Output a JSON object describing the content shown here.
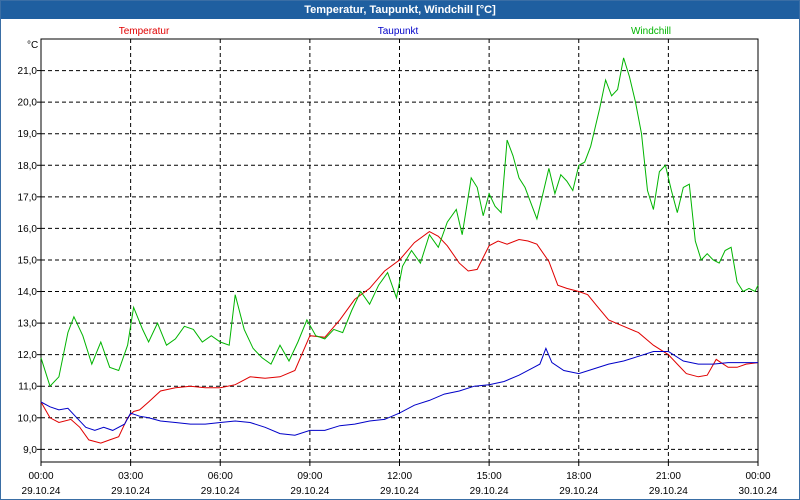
{
  "window": {
    "title": "Temperatur, Taupunkt, Windchill [°C]"
  },
  "chart_data": {
    "type": "line",
    "title": "Temperatur, Taupunkt, Windchill [°C]",
    "ylabel": "°C",
    "ylim": [
      8.6,
      22.0
    ],
    "yticks": [
      "9,0",
      "10,0",
      "11,0",
      "12,0",
      "13,0",
      "14,0",
      "15,0",
      "16,0",
      "17,0",
      "18,0",
      "19,0",
      "20,0",
      "21,0"
    ],
    "xlim": [
      0,
      24
    ],
    "xticks": [
      {
        "time": "00:00",
        "date": "29.10.24"
      },
      {
        "time": "03:00",
        "date": "29.10.24"
      },
      {
        "time": "06:00",
        "date": "29.10.24"
      },
      {
        "time": "09:00",
        "date": "29.10.24"
      },
      {
        "time": "12:00",
        "date": "29.10.24"
      },
      {
        "time": "15:00",
        "date": "29.10.24"
      },
      {
        "time": "18:00",
        "date": "29.10.24"
      },
      {
        "time": "21:00",
        "date": "29.10.24"
      },
      {
        "time": "00:00",
        "date": "30.10.24"
      }
    ],
    "grid": true,
    "legend_position": "top",
    "series": [
      {
        "name": "Temperatur",
        "color": "#e00000",
        "points": [
          [
            0,
            10.5
          ],
          [
            0.3,
            10.0
          ],
          [
            0.6,
            9.85
          ],
          [
            1.0,
            9.95
          ],
          [
            1.3,
            9.7
          ],
          [
            1.6,
            9.3
          ],
          [
            2.0,
            9.2
          ],
          [
            2.3,
            9.3
          ],
          [
            2.6,
            9.4
          ],
          [
            2.9,
            10.0
          ],
          [
            3.1,
            10.2
          ],
          [
            3.3,
            10.25
          ],
          [
            3.6,
            10.5
          ],
          [
            4.0,
            10.85
          ],
          [
            4.5,
            10.95
          ],
          [
            5.0,
            11.0
          ],
          [
            5.5,
            10.95
          ],
          [
            6.0,
            10.95
          ],
          [
            6.5,
            11.05
          ],
          [
            7.0,
            11.3
          ],
          [
            7.5,
            11.25
          ],
          [
            8.0,
            11.3
          ],
          [
            8.5,
            11.5
          ],
          [
            9.0,
            12.6
          ],
          [
            9.5,
            12.55
          ],
          [
            10.0,
            13.1
          ],
          [
            10.5,
            13.75
          ],
          [
            11.0,
            14.1
          ],
          [
            11.5,
            14.65
          ],
          [
            12.0,
            15.0
          ],
          [
            12.5,
            15.55
          ],
          [
            13.0,
            15.9
          ],
          [
            13.3,
            15.75
          ],
          [
            13.6,
            15.45
          ],
          [
            14.0,
            14.9
          ],
          [
            14.3,
            14.65
          ],
          [
            14.6,
            14.7
          ],
          [
            15.0,
            15.45
          ],
          [
            15.3,
            15.6
          ],
          [
            15.6,
            15.5
          ],
          [
            16.0,
            15.65
          ],
          [
            16.3,
            15.6
          ],
          [
            16.6,
            15.5
          ],
          [
            17.0,
            14.95
          ],
          [
            17.3,
            14.2
          ],
          [
            17.6,
            14.1
          ],
          [
            18.0,
            14.0
          ],
          [
            18.3,
            13.9
          ],
          [
            18.6,
            13.55
          ],
          [
            19.0,
            13.1
          ],
          [
            19.5,
            12.9
          ],
          [
            20.0,
            12.7
          ],
          [
            20.5,
            12.3
          ],
          [
            21.0,
            12.0
          ],
          [
            21.3,
            11.7
          ],
          [
            21.6,
            11.4
          ],
          [
            22.0,
            11.3
          ],
          [
            22.3,
            11.35
          ],
          [
            22.6,
            11.85
          ],
          [
            23.0,
            11.6
          ],
          [
            23.3,
            11.6
          ],
          [
            23.6,
            11.7
          ],
          [
            24.0,
            11.75
          ]
        ]
      },
      {
        "name": "Taupunkt",
        "color": "#0000c8",
        "points": [
          [
            0,
            10.5
          ],
          [
            0.3,
            10.35
          ],
          [
            0.6,
            10.25
          ],
          [
            0.9,
            10.3
          ],
          [
            1.2,
            10.0
          ],
          [
            1.5,
            9.7
          ],
          [
            1.8,
            9.6
          ],
          [
            2.1,
            9.7
          ],
          [
            2.4,
            9.6
          ],
          [
            2.8,
            9.8
          ],
          [
            3.0,
            10.15
          ],
          [
            3.3,
            10.05
          ],
          [
            3.6,
            10.0
          ],
          [
            4.0,
            9.9
          ],
          [
            4.5,
            9.85
          ],
          [
            5.0,
            9.8
          ],
          [
            5.5,
            9.8
          ],
          [
            6.0,
            9.85
          ],
          [
            6.5,
            9.9
          ],
          [
            7.0,
            9.85
          ],
          [
            7.5,
            9.7
          ],
          [
            8.0,
            9.5
          ],
          [
            8.5,
            9.45
          ],
          [
            9.0,
            9.6
          ],
          [
            9.5,
            9.6
          ],
          [
            10.0,
            9.75
          ],
          [
            10.5,
            9.8
          ],
          [
            11.0,
            9.9
          ],
          [
            11.5,
            9.95
          ],
          [
            12.0,
            10.15
          ],
          [
            12.5,
            10.4
          ],
          [
            13.0,
            10.55
          ],
          [
            13.5,
            10.75
          ],
          [
            14.0,
            10.85
          ],
          [
            14.5,
            11.0
          ],
          [
            15.0,
            11.05
          ],
          [
            15.5,
            11.15
          ],
          [
            16.0,
            11.35
          ],
          [
            16.5,
            11.6
          ],
          [
            16.7,
            11.7
          ],
          [
            16.9,
            12.2
          ],
          [
            17.1,
            11.75
          ],
          [
            17.5,
            11.5
          ],
          [
            18.0,
            11.4
          ],
          [
            18.5,
            11.55
          ],
          [
            19.0,
            11.7
          ],
          [
            19.5,
            11.8
          ],
          [
            20.0,
            11.95
          ],
          [
            20.5,
            12.1
          ],
          [
            21.0,
            12.1
          ],
          [
            21.5,
            11.8
          ],
          [
            22.0,
            11.7
          ],
          [
            22.5,
            11.7
          ],
          [
            23.0,
            11.75
          ],
          [
            23.5,
            11.75
          ],
          [
            24.0,
            11.75
          ]
        ]
      },
      {
        "name": "Windchill",
        "color": "#00b400",
        "points": [
          [
            0,
            11.9
          ],
          [
            0.3,
            11.0
          ],
          [
            0.6,
            11.3
          ],
          [
            0.9,
            12.7
          ],
          [
            1.1,
            13.2
          ],
          [
            1.4,
            12.6
          ],
          [
            1.7,
            11.7
          ],
          [
            2.0,
            12.4
          ],
          [
            2.3,
            11.6
          ],
          [
            2.6,
            11.5
          ],
          [
            2.9,
            12.3
          ],
          [
            3.1,
            13.5
          ],
          [
            3.4,
            12.8
          ],
          [
            3.6,
            12.4
          ],
          [
            3.9,
            13.0
          ],
          [
            4.2,
            12.3
          ],
          [
            4.5,
            12.5
          ],
          [
            4.8,
            12.9
          ],
          [
            5.1,
            12.8
          ],
          [
            5.4,
            12.4
          ],
          [
            5.7,
            12.6
          ],
          [
            6.0,
            12.4
          ],
          [
            6.3,
            12.3
          ],
          [
            6.5,
            13.9
          ],
          [
            6.8,
            12.8
          ],
          [
            7.1,
            12.2
          ],
          [
            7.4,
            11.9
          ],
          [
            7.7,
            11.7
          ],
          [
            8.0,
            12.3
          ],
          [
            8.3,
            11.8
          ],
          [
            8.6,
            12.4
          ],
          [
            8.9,
            13.1
          ],
          [
            9.2,
            12.6
          ],
          [
            9.5,
            12.5
          ],
          [
            9.8,
            12.8
          ],
          [
            10.1,
            12.7
          ],
          [
            10.4,
            13.4
          ],
          [
            10.7,
            14.0
          ],
          [
            11.0,
            13.6
          ],
          [
            11.3,
            14.2
          ],
          [
            11.6,
            14.6
          ],
          [
            11.9,
            13.8
          ],
          [
            12.1,
            14.8
          ],
          [
            12.4,
            15.3
          ],
          [
            12.7,
            14.9
          ],
          [
            13.0,
            15.8
          ],
          [
            13.3,
            15.4
          ],
          [
            13.6,
            16.2
          ],
          [
            13.9,
            16.6
          ],
          [
            14.1,
            15.8
          ],
          [
            14.4,
            17.6
          ],
          [
            14.6,
            17.3
          ],
          [
            14.8,
            16.4
          ],
          [
            15.0,
            17.1
          ],
          [
            15.2,
            16.7
          ],
          [
            15.4,
            16.5
          ],
          [
            15.6,
            18.8
          ],
          [
            15.8,
            18.3
          ],
          [
            16.0,
            17.6
          ],
          [
            16.2,
            17.3
          ],
          [
            16.4,
            16.8
          ],
          [
            16.6,
            16.3
          ],
          [
            16.8,
            17.1
          ],
          [
            17.0,
            17.9
          ],
          [
            17.2,
            17.1
          ],
          [
            17.4,
            17.7
          ],
          [
            17.6,
            17.5
          ],
          [
            17.8,
            17.2
          ],
          [
            18.0,
            18.0
          ],
          [
            18.2,
            18.1
          ],
          [
            18.4,
            18.6
          ],
          [
            18.7,
            19.8
          ],
          [
            18.9,
            20.7
          ],
          [
            19.1,
            20.2
          ],
          [
            19.3,
            20.4
          ],
          [
            19.5,
            21.4
          ],
          [
            19.7,
            20.8
          ],
          [
            19.9,
            20.0
          ],
          [
            20.1,
            19.0
          ],
          [
            20.3,
            17.2
          ],
          [
            20.5,
            16.6
          ],
          [
            20.7,
            17.8
          ],
          [
            20.9,
            18.0
          ],
          [
            21.1,
            17.2
          ],
          [
            21.3,
            16.5
          ],
          [
            21.5,
            17.3
          ],
          [
            21.7,
            17.4
          ],
          [
            21.9,
            15.6
          ],
          [
            22.1,
            15.0
          ],
          [
            22.3,
            15.2
          ],
          [
            22.5,
            15.0
          ],
          [
            22.7,
            14.9
          ],
          [
            22.9,
            15.3
          ],
          [
            23.1,
            15.4
          ],
          [
            23.3,
            14.3
          ],
          [
            23.5,
            14.0
          ],
          [
            23.7,
            14.1
          ],
          [
            23.9,
            14.0
          ],
          [
            24.0,
            14.2
          ]
        ]
      }
    ]
  }
}
